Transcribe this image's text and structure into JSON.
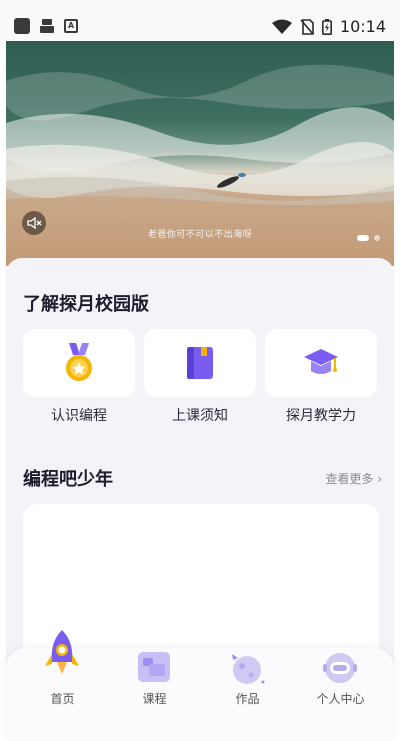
{
  "status_bar": {
    "time": "10:14"
  },
  "hero": {
    "caption": "老爸你可不可以不出海呀"
  },
  "sections": {
    "about": {
      "title": "了解探月校园版"
    },
    "program": {
      "title": "编程吧少年",
      "more": "查看更多 ›"
    }
  },
  "cards": [
    {
      "label": "认识编程",
      "icon": "medal-icon"
    },
    {
      "label": "上课须知",
      "icon": "book-icon"
    },
    {
      "label": "探月教学力",
      "icon": "graduation-cap-icon"
    }
  ],
  "tabs": [
    {
      "label": "首页",
      "icon": "rocket-icon",
      "active": true
    },
    {
      "label": "课程",
      "icon": "course-icon"
    },
    {
      "label": "作品",
      "icon": "planet-icon"
    },
    {
      "label": "个人中心",
      "icon": "astronaut-icon"
    }
  ],
  "colors": {
    "accent": "#7a5cf0",
    "gold": "#f5b400",
    "panel": "#f4f4f8"
  }
}
